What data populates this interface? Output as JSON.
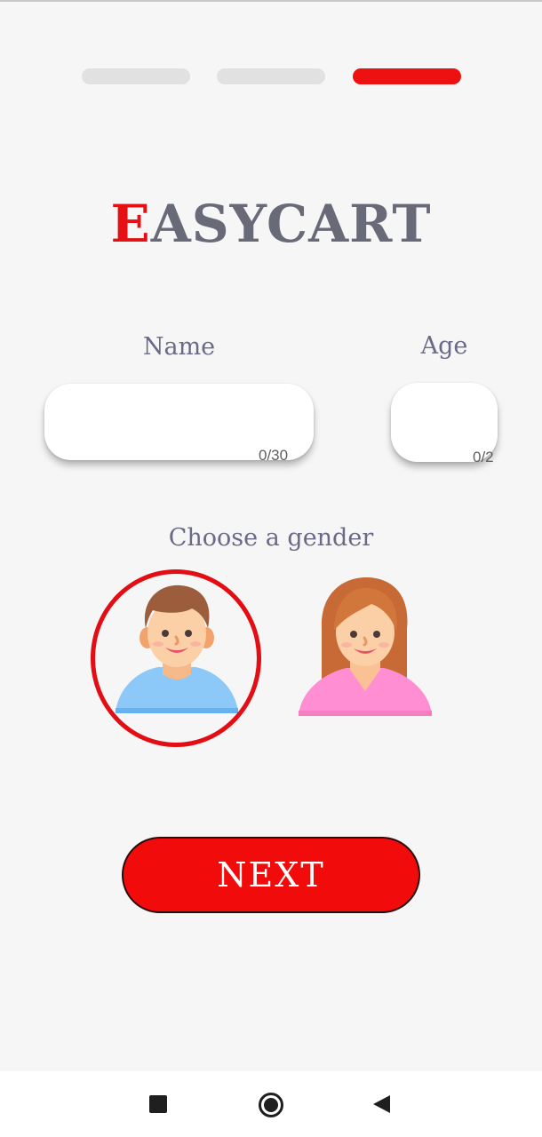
{
  "progress": {
    "steps": 3,
    "current": 3
  },
  "logo": {
    "first_letter": "E",
    "rest": "ASYCART"
  },
  "form": {
    "name": {
      "label": "Name",
      "value": "",
      "counter": "0/30"
    },
    "age": {
      "label": "Age",
      "value": "",
      "counter": "0/2"
    }
  },
  "gender": {
    "prompt": "Choose a gender",
    "options": [
      {
        "id": "male",
        "icon": "male-avatar-icon",
        "selected": true
      },
      {
        "id": "female",
        "icon": "female-avatar-icon",
        "selected": false
      }
    ]
  },
  "next_button": {
    "label": "NEXT"
  },
  "colors": {
    "accent": "#ee1111",
    "inactive_step": "#e1e1e1",
    "logo_text": "#686a78",
    "label_text": "#6a6a88",
    "background": "#f6f6f6"
  },
  "navbar": {
    "icons": [
      "recents-square-icon",
      "home-circle-icon",
      "back-triangle-icon"
    ]
  }
}
